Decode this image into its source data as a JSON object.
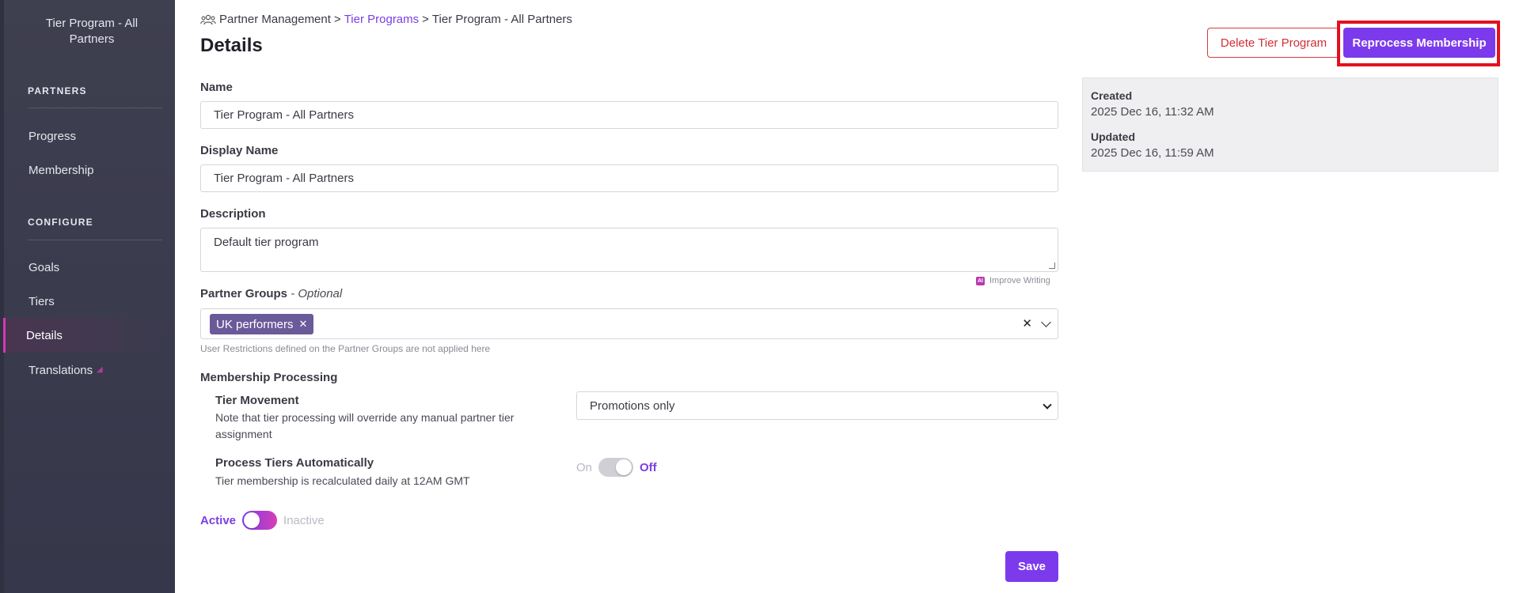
{
  "sidebar": {
    "title": "Tier Program - All Partners",
    "sections": [
      {
        "label": "PARTNERS",
        "items": [
          {
            "label": "Progress"
          },
          {
            "label": "Membership"
          }
        ]
      },
      {
        "label": "CONFIGURE",
        "items": [
          {
            "label": "Goals"
          },
          {
            "label": "Tiers"
          },
          {
            "label": "Details"
          },
          {
            "label": "Translations"
          }
        ]
      }
    ],
    "active_item": "Details"
  },
  "breadcrumb": {
    "root": "Partner Management",
    "sep1": ">",
    "link": "Tier Programs",
    "sep2": ">",
    "current": "Tier Program - All Partners"
  },
  "page_title": "Details",
  "actions": {
    "delete_label": "Delete Tier Program",
    "reprocess_label": "Reprocess Membership"
  },
  "meta": {
    "created_label": "Created",
    "created_value": "2025 Dec 16, 11:32 AM",
    "updated_label": "Updated",
    "updated_value": "2025 Dec 16, 11:59 AM"
  },
  "form": {
    "name_label": "Name",
    "name_value": "Tier Program - All Partners",
    "display_name_label": "Display Name",
    "display_name_value": "Tier Program - All Partners",
    "description_label": "Description",
    "description_value": "Default tier program",
    "improve_writing": "Improve Writing",
    "partner_groups_label": "Partner Groups",
    "partner_groups_optional": "- Optional",
    "partner_groups_chips": [
      "UK performers"
    ],
    "partner_groups_hint": "User Restrictions defined on the Partner Groups are not applied here",
    "membership_processing_label": "Membership Processing",
    "tier_movement_label": "Tier Movement",
    "tier_movement_desc": "Note that tier processing will override any manual partner tier assignment",
    "tier_movement_value": "Promotions only",
    "process_auto_label": "Process Tiers Automatically",
    "process_auto_desc": "Tier membership is recalculated daily at 12AM GMT",
    "process_auto_on": "On",
    "process_auto_off": "Off",
    "process_auto_state": "Off",
    "status_active": "Active",
    "status_inactive": "Inactive",
    "status_state": "Active",
    "save_label": "Save"
  },
  "colors": {
    "accent": "#7c3aed",
    "danger": "#d22e36",
    "sidebar_bg": "#3e3f4f",
    "highlight": "#e3101f"
  }
}
